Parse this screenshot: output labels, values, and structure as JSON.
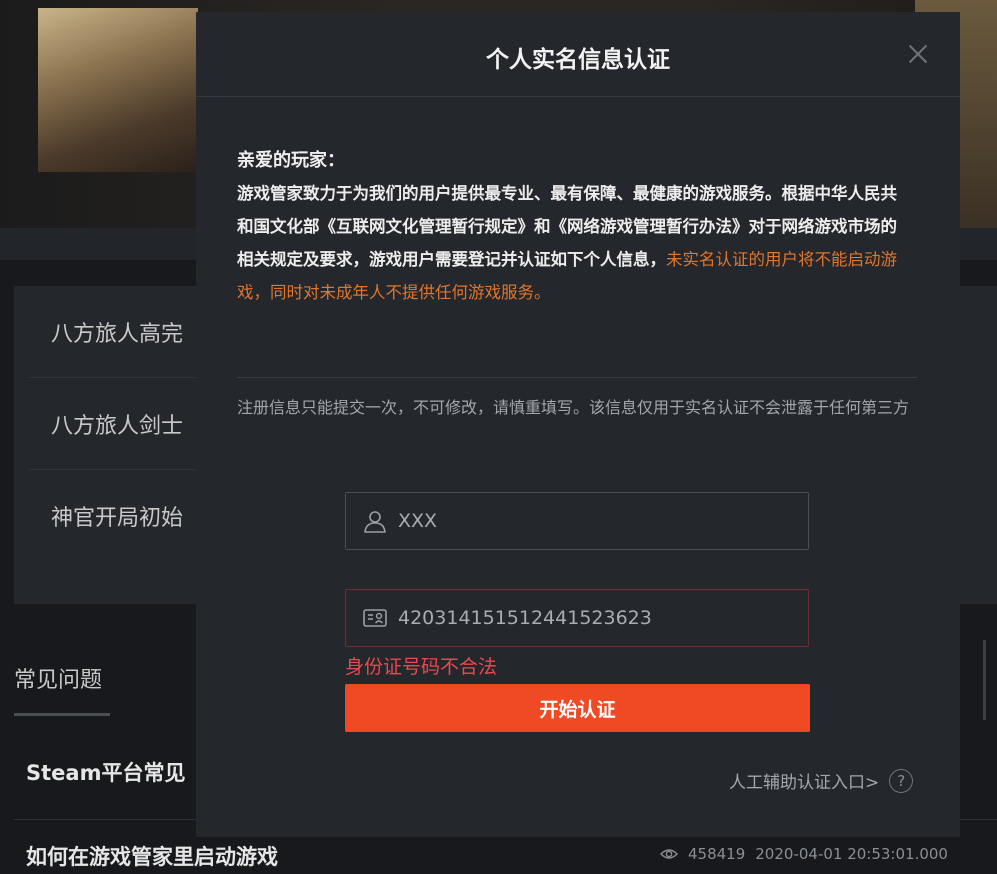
{
  "background": {
    "list_items": [
      "八方旅人高完",
      "八方旅人剑士",
      "神官开局初始"
    ],
    "faq_title": "常见问题",
    "faq_items": [
      "Steam平台常见",
      "如何在游戏管家里启动游戏"
    ],
    "view_count": "458419",
    "timestamp": "2020-04-01 20:53:01.000"
  },
  "modal": {
    "title": "个人实名信息认证",
    "greeting": "亲爱的玩家：",
    "intro_main": "游戏管家致力于为我们的用户提供最专业、最有保障、最健康的游戏服务。根据中华人民共和国文化部《互联网文化管理暂行规定》和《网络游戏管理暂行办法》对于网络游戏市场的相关规定及要求，游戏用户需要登记并认证如下个人信息，",
    "intro_warning": "未实名认证的用户将不能启动游戏，同时对未成年人不提供任何游戏服务。",
    "notice": "注册信息只能提交一次，不可修改，请慎重填写。该信息仅用于实名认证不会泄露于任何第三方",
    "name_field": {
      "value": "XXX",
      "icon": "user-icon"
    },
    "id_field": {
      "value": "420314151512441523623",
      "icon": "id-card-icon"
    },
    "error_message": "身份证号码不合法",
    "submit_label": "开始认证",
    "manual_link": "人工辅助认证入口>",
    "help_icon_glyph": "?"
  },
  "colors": {
    "accent": "#ef4a24",
    "warning_text": "#e0762e",
    "error_text": "#e84a4f"
  }
}
